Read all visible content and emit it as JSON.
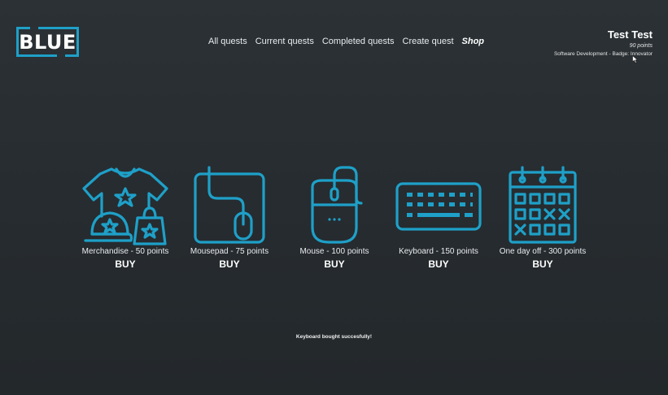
{
  "logo": {
    "text": "BLUE"
  },
  "nav": {
    "items": [
      {
        "label": "All quests"
      },
      {
        "label": "Current quests"
      },
      {
        "label": "Completed quests"
      },
      {
        "label": "Create quest"
      },
      {
        "label": "Shop",
        "active": true
      }
    ]
  },
  "user": {
    "name": "Test Test",
    "points": "90 points",
    "meta": "Software Development - Badge: Innovator"
  },
  "shop": {
    "buy_label": "BUY",
    "items": [
      {
        "label": "Merchandise - 50 points",
        "icon": "merchandise-icon"
      },
      {
        "label": "Mousepad - 75 points",
        "icon": "mousepad-icon"
      },
      {
        "label": "Mouse - 100 points",
        "icon": "mouse-icon"
      },
      {
        "label": "Keyboard - 150 points",
        "icon": "keyboard-icon"
      },
      {
        "label": "One day off - 300 points",
        "icon": "calendar-icon"
      }
    ]
  },
  "notice": "Keyboard bought succesfully!",
  "colors": {
    "accent": "#1ea0c8",
    "background": "#2b3135",
    "text": "#ffffff"
  }
}
